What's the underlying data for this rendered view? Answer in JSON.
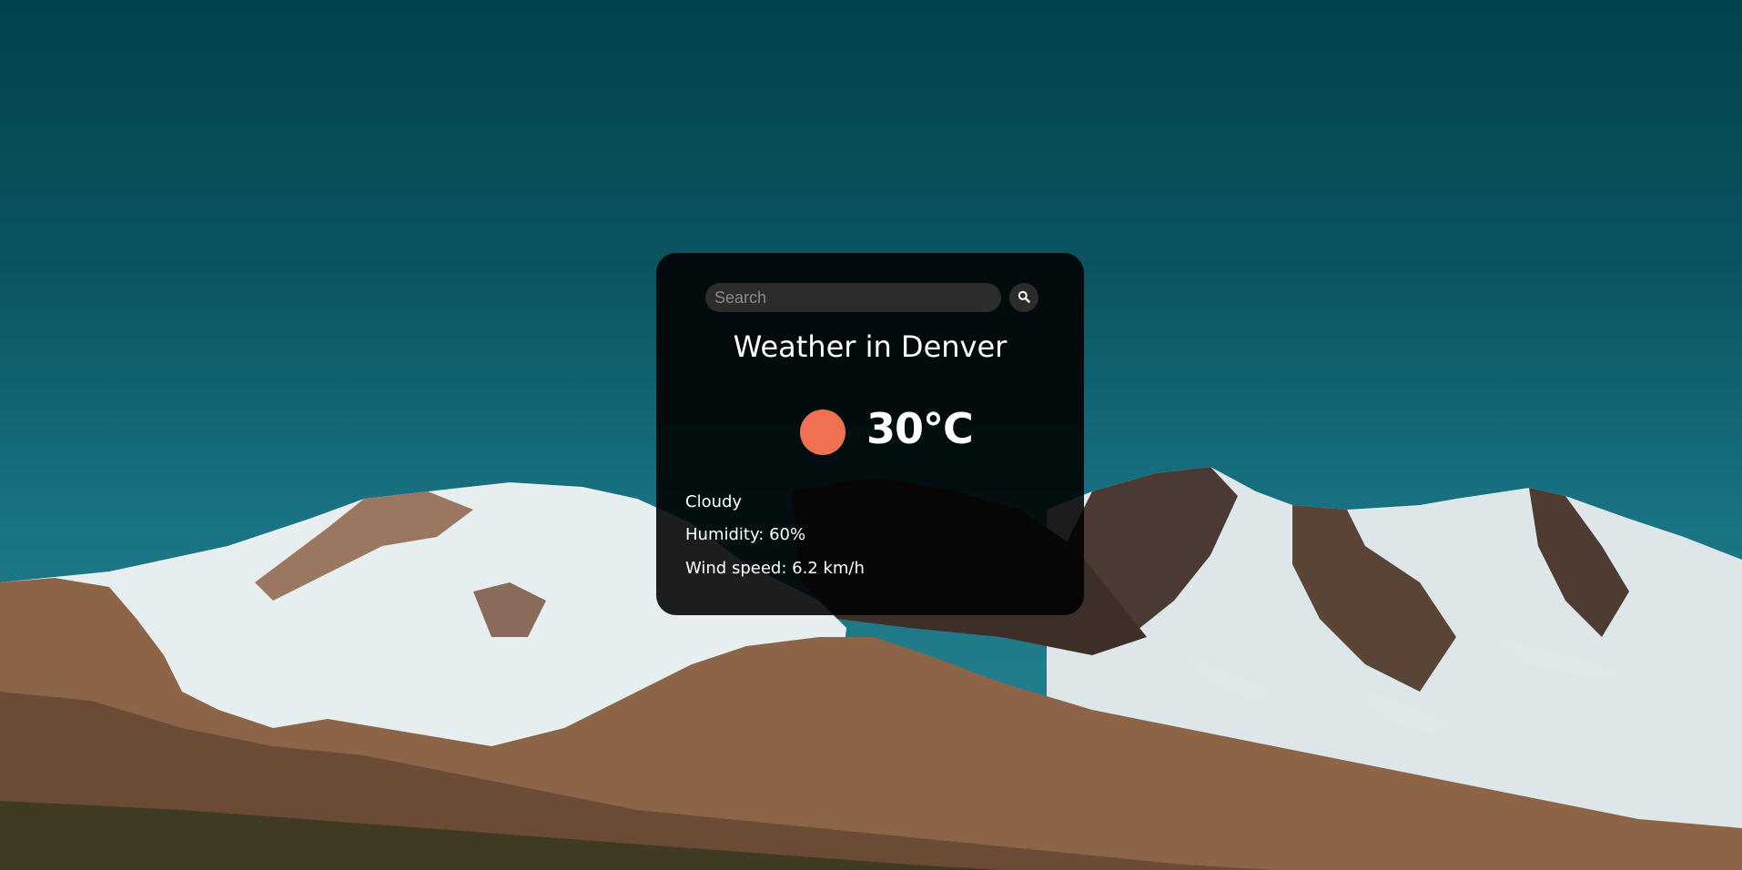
{
  "search": {
    "placeholder": "Search",
    "value": ""
  },
  "weather": {
    "city_title": "Weather in Denver",
    "temperature": "30°C",
    "description": "Cloudy",
    "humidity": "Humidity: 60%",
    "wind": "Wind speed: 6.2 km/h"
  },
  "icons": {
    "search_button_icon": "magnifier",
    "weather_icon": "sun-circle"
  },
  "colors": {
    "weather_icon": "#f07151",
    "card_background": "#000000",
    "search_field": "#2c2c2c",
    "text": "#ffffff"
  }
}
